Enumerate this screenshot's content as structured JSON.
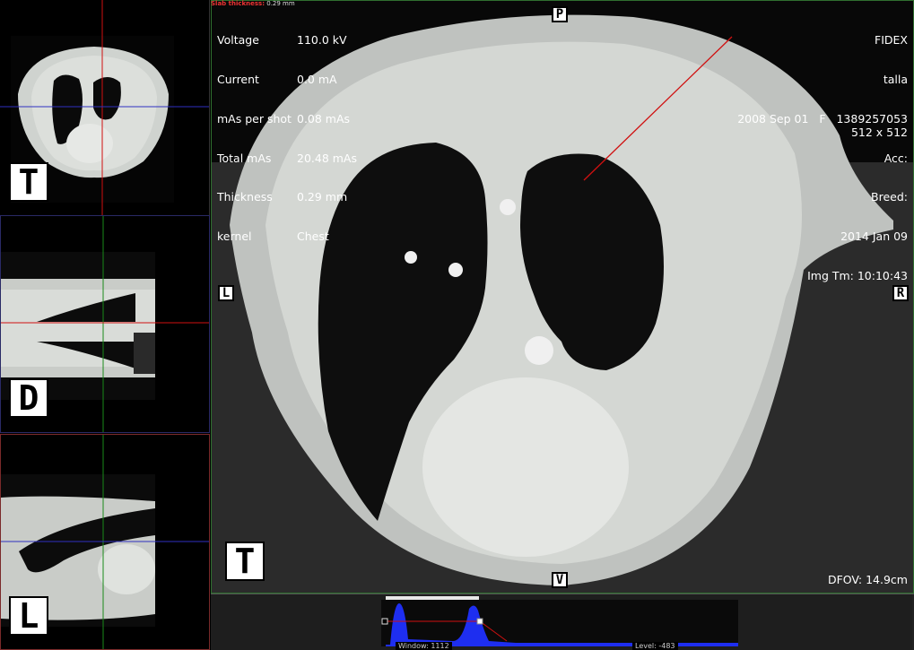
{
  "main_view": {
    "slab_thickness_label": "Slab thickness:",
    "slab_thickness_value": "0.29 mm",
    "acquisition": [
      {
        "key": "Voltage",
        "value": "110.0 kV"
      },
      {
        "key": "Current",
        "value": "0.0 mA"
      },
      {
        "key": "mAs per shot",
        "value": "0.08 mAs"
      },
      {
        "key": "Total mAs",
        "value": "20.48 mAs"
      },
      {
        "key": "Thickness",
        "value": "0.29 mm"
      },
      {
        "key": "kernel",
        "value": "Chest"
      }
    ],
    "patient": {
      "name": "FIDEX",
      "owner": "talla",
      "dob_sex_id": "2008 Sep 01   F   1389257053",
      "acc": "Acc:",
      "breed": "Breed:",
      "study_date": "2014 Jan 09",
      "image_time": "Img Tm: 10:10:43"
    },
    "matrix": "512 x 512",
    "dfov": "DFOV: 14.9cm",
    "orient_top": "P",
    "orient_left": "L",
    "orient_right": "R",
    "orient_bottom": "V",
    "plane": "T"
  },
  "minis": {
    "top_plane": "T",
    "mid_plane": "D",
    "bot_plane": "L"
  },
  "histogram": {
    "window_label": "Window: 1112",
    "level_label": "Level: -483"
  },
  "colors": {
    "crosshair_red": "#d01010",
    "crosshair_green": "#1a8a1a",
    "crosshair_blue": "#3030c0",
    "histogram_fill": "#1e2ef0"
  }
}
